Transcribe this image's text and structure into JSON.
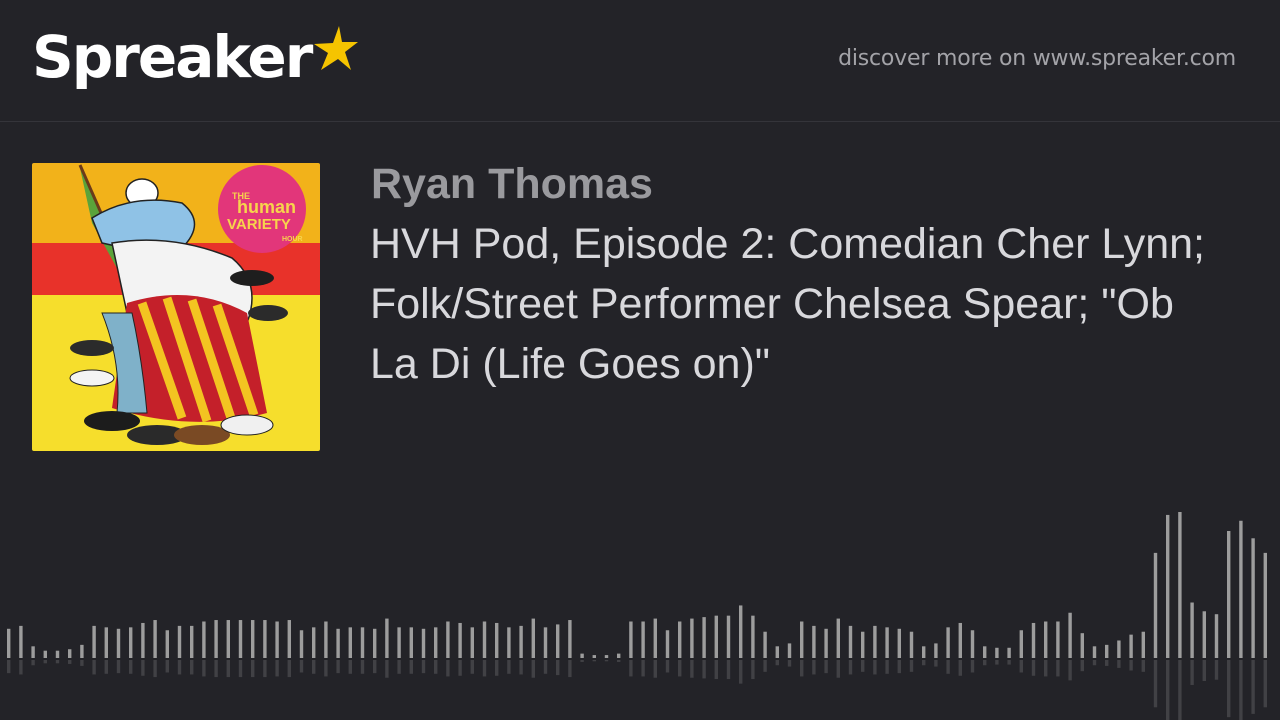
{
  "header": {
    "brand": "Spreaker",
    "discover_text": "discover more on www.spreaker.com"
  },
  "episode": {
    "author": "Ryan Thomas",
    "title": "HVH Pod, Episode 2: Comedian Cher Lynn; Folk/Street Performer Chelsea Spear; \"Ob La Di (Life Goes on)\""
  },
  "cover": {
    "badge_line1": "THE",
    "badge_line2": "human",
    "badge_line3": "VARIETY",
    "badge_line4": "HOUR"
  },
  "colors": {
    "background": "#232328",
    "star": "#f5c400",
    "wave": "#9d9d9d"
  },
  "waveform": {
    "levels": [
      0.2,
      0.22,
      0.08,
      0.05,
      0.05,
      0.06,
      0.09,
      0.22,
      0.21,
      0.2,
      0.21,
      0.24,
      0.26,
      0.19,
      0.22,
      0.22,
      0.25,
      0.26,
      0.26,
      0.26,
      0.26,
      0.26,
      0.25,
      0.26,
      0.19,
      0.21,
      0.25,
      0.2,
      0.21,
      0.21,
      0.2,
      0.27,
      0.21,
      0.21,
      0.2,
      0.21,
      0.25,
      0.24,
      0.21,
      0.25,
      0.24,
      0.21,
      0.22,
      0.27,
      0.21,
      0.23,
      0.26,
      0.03,
      0.02,
      0.02,
      0.03,
      0.25,
      0.25,
      0.27,
      0.19,
      0.25,
      0.27,
      0.28,
      0.29,
      0.29,
      0.36,
      0.29,
      0.18,
      0.08,
      0.1,
      0.25,
      0.22,
      0.2,
      0.27,
      0.22,
      0.18,
      0.22,
      0.21,
      0.2,
      0.18,
      0.08,
      0.1,
      0.21,
      0.24,
      0.19,
      0.08,
      0.07,
      0.07,
      0.19,
      0.24,
      0.25,
      0.25,
      0.31,
      0.17,
      0.08,
      0.09,
      0.12,
      0.16,
      0.18,
      0.72,
      0.98,
      1.0,
      0.38,
      0.32,
      0.3,
      0.87,
      0.94,
      0.82,
      0.72
    ]
  }
}
